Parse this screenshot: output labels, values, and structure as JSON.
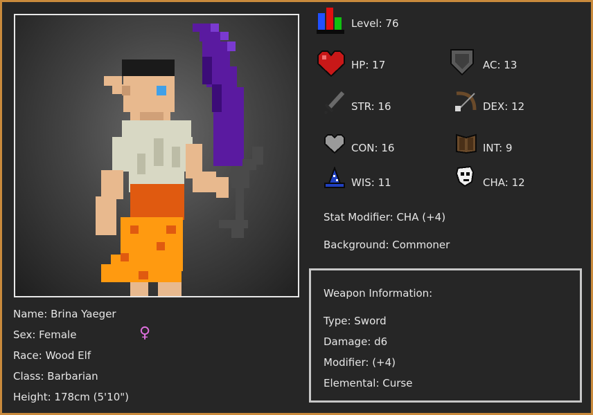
{
  "character": {
    "name_line": "Name: Brina Yaeger",
    "sex_line": "Sex: Female",
    "sex_symbol": "♀",
    "race_line": "Race: Wood Elf",
    "class_line": "Class: Barbarian",
    "height_line": "Height: 178cm (5'10\")"
  },
  "stats": {
    "level": "Level: 76",
    "hp": "HP: 17",
    "ac": "AC: 13",
    "str": "STR: 16",
    "dex": "DEX: 12",
    "con": "CON: 16",
    "int": "INT: 9",
    "wis": "WIS: 11",
    "cha": "CHA: 12",
    "stat_modifier": "Stat Modifier: CHA (+4)",
    "background": "Background: Commoner"
  },
  "weapon": {
    "heading": "Weapon Information:",
    "type": "Type: Sword",
    "damage": "Damage: d6",
    "modifier": "Modifier: (+4)",
    "elemental": "Elemental: Curse"
  },
  "icons": {
    "level": "level-bars-icon",
    "hp": "heart-icon",
    "ac": "shield-icon",
    "str": "sword-icon",
    "dex": "bow-icon",
    "con": "gray-heart-icon",
    "int": "book-icon",
    "wis": "wizard-hat-icon",
    "cha": "mask-icon"
  },
  "colors": {
    "frame": "#c98a3c",
    "panel": "#262626",
    "text": "#e6e6e6",
    "sex_symbol": "#e070e0"
  }
}
